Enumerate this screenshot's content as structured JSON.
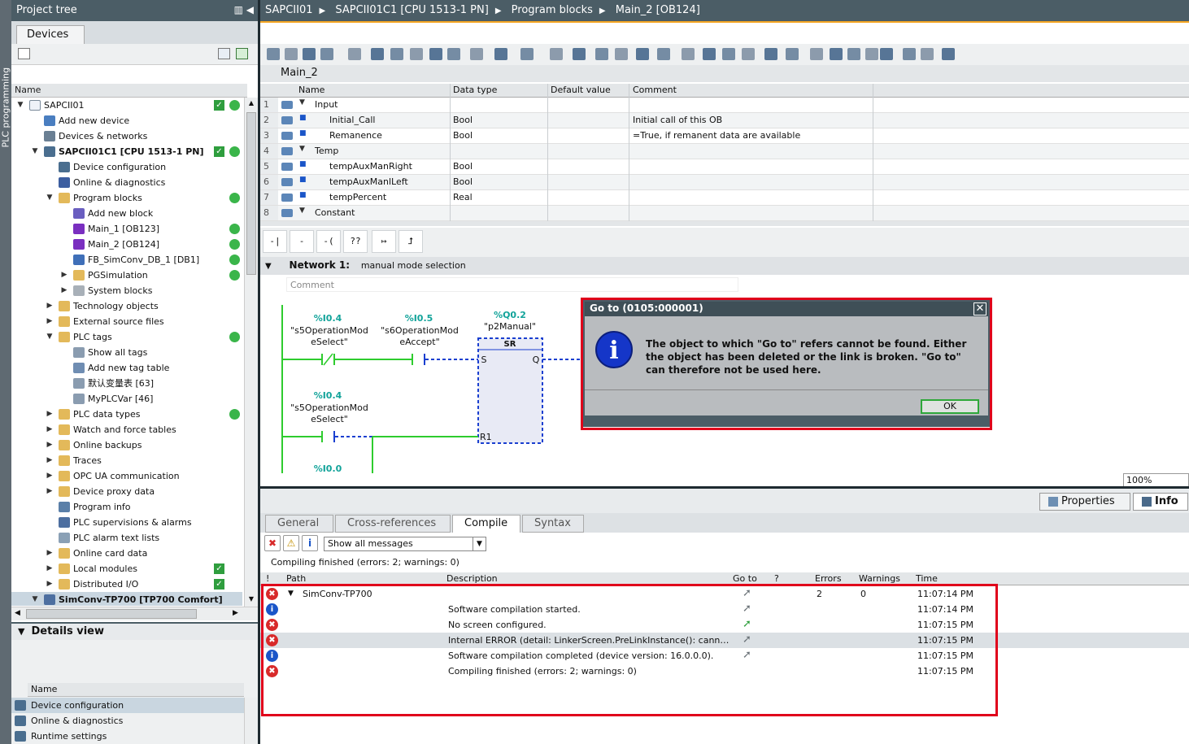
{
  "left_strip_label": "PLC programming",
  "project_tree": {
    "title": "Project tree",
    "tab": "Devices",
    "column_name": "Name",
    "items": [
      {
        "label": "SAPCII01",
        "level": 0,
        "toggle": "▼",
        "icon": "project-icon",
        "check": true,
        "status": true
      },
      {
        "label": "Add new device",
        "level": 1,
        "toggle": "",
        "icon": "add-device-icon",
        "check": false,
        "status": false
      },
      {
        "label": "Devices & networks",
        "level": 1,
        "toggle": "",
        "icon": "network-icon",
        "check": false,
        "status": false
      },
      {
        "label": "SAPCII01C1 [CPU 1513-1 PN]",
        "level": 1,
        "toggle": "▼",
        "icon": "cpu-icon",
        "check": true,
        "status": true,
        "bold": true
      },
      {
        "label": "Device configuration",
        "level": 2,
        "toggle": "",
        "icon": "device-config-icon",
        "check": false,
        "status": false
      },
      {
        "label": "Online & diagnostics",
        "level": 2,
        "toggle": "",
        "icon": "diagnostics-icon",
        "check": false,
        "status": false
      },
      {
        "label": "Program blocks",
        "level": 2,
        "toggle": "▼",
        "icon": "folder-icon",
        "check": false,
        "status": true
      },
      {
        "label": "Add new block",
        "level": 3,
        "toggle": "",
        "icon": "add-block-icon",
        "check": false,
        "status": false
      },
      {
        "label": "Main_1 [OB123]",
        "level": 3,
        "toggle": "",
        "icon": "ob-icon",
        "check": false,
        "status": true
      },
      {
        "label": "Main_2 [OB124]",
        "level": 3,
        "toggle": "",
        "icon": "ob-icon",
        "check": false,
        "status": true
      },
      {
        "label": "FB_SimConv_DB_1 [DB1]",
        "level": 3,
        "toggle": "",
        "icon": "db-icon",
        "check": false,
        "status": true
      },
      {
        "label": "PGSimulation",
        "level": 3,
        "toggle": "▶",
        "icon": "folder-icon",
        "check": false,
        "status": true
      },
      {
        "label": "System blocks",
        "level": 3,
        "toggle": "▶",
        "icon": "system-folder-icon",
        "check": false,
        "status": false
      },
      {
        "label": "Technology objects",
        "level": 2,
        "toggle": "▶",
        "icon": "folder-icon",
        "check": false,
        "status": false
      },
      {
        "label": "External source files",
        "level": 2,
        "toggle": "▶",
        "icon": "folder-icon",
        "check": false,
        "status": false
      },
      {
        "label": "PLC tags",
        "level": 2,
        "toggle": "▼",
        "icon": "folder-icon",
        "check": false,
        "status": true
      },
      {
        "label": "Show all tags",
        "level": 3,
        "toggle": "",
        "icon": "tag-table-icon",
        "check": false,
        "status": false
      },
      {
        "label": "Add new tag table",
        "level": 3,
        "toggle": "",
        "icon": "add-tag-table-icon",
        "check": false,
        "status": false
      },
      {
        "label": "默认变量表 [63]",
        "level": 3,
        "toggle": "",
        "icon": "tag-table-icon",
        "check": false,
        "status": false
      },
      {
        "label": "MyPLCVar [46]",
        "level": 3,
        "toggle": "",
        "icon": "tag-table-icon",
        "check": false,
        "status": false
      },
      {
        "label": "PLC data types",
        "level": 2,
        "toggle": "▶",
        "icon": "folder-icon",
        "check": false,
        "status": true
      },
      {
        "label": "Watch and force tables",
        "level": 2,
        "toggle": "▶",
        "icon": "folder-icon",
        "check": false,
        "status": false
      },
      {
        "label": "Online backups",
        "level": 2,
        "toggle": "▶",
        "icon": "folder-icon",
        "check": false,
        "status": false
      },
      {
        "label": "Traces",
        "level": 2,
        "toggle": "▶",
        "icon": "folder-icon",
        "check": false,
        "status": false
      },
      {
        "label": "OPC UA communication",
        "level": 2,
        "toggle": "▶",
        "icon": "folder-icon",
        "check": false,
        "status": false
      },
      {
        "label": "Device proxy data",
        "level": 2,
        "toggle": "▶",
        "icon": "folder-icon",
        "check": false,
        "status": false
      },
      {
        "label": "Program info",
        "level": 2,
        "toggle": "",
        "icon": "program-info-icon",
        "check": false,
        "status": false
      },
      {
        "label": "PLC supervisions & alarms",
        "level": 2,
        "toggle": "",
        "icon": "alarms-icon",
        "check": false,
        "status": false
      },
      {
        "label": "PLC alarm text lists",
        "level": 2,
        "toggle": "",
        "icon": "text-list-icon",
        "check": false,
        "status": false
      },
      {
        "label": "Online card data",
        "level": 2,
        "toggle": "▶",
        "icon": "folder-icon",
        "check": false,
        "status": false
      },
      {
        "label": "Local modules",
        "level": 2,
        "toggle": "▶",
        "icon": "folder-icon",
        "check": true,
        "status": false
      },
      {
        "label": "Distributed I/O",
        "level": 2,
        "toggle": "▶",
        "icon": "folder-icon",
        "check": true,
        "status": false
      },
      {
        "label": "SimConv-TP700 [TP700 Comfort]",
        "level": 1,
        "toggle": "▼",
        "icon": "hmi-icon",
        "check": false,
        "status": false,
        "bold": true,
        "selected": true
      }
    ]
  },
  "details_view": {
    "title": "Details view",
    "column_name": "Name",
    "items": [
      {
        "label": "Device configuration",
        "icon": "device-config-icon",
        "selected": true
      },
      {
        "label": "Online & diagnostics",
        "icon": "diagnostics-icon"
      },
      {
        "label": "Runtime settings",
        "icon": "runtime-settings-icon"
      }
    ]
  },
  "breadcrumb": [
    "SAPCII01",
    "SAPCII01C1 [CPU 1513-1 PN]",
    "Program blocks",
    "Main_2 [OB124]"
  ],
  "block_title": "Main_2",
  "interface": {
    "headers": {
      "name": "Name",
      "type": "Data type",
      "default": "Default value",
      "comment": "Comment"
    },
    "rows": [
      {
        "n": "1",
        "name": "Input",
        "indent": 0,
        "section": true,
        "type": "",
        "default": "",
        "comment": ""
      },
      {
        "n": "2",
        "name": "Initial_Call",
        "indent": 1,
        "section": false,
        "type": "Bool",
        "default": "",
        "comment": "Initial call of this OB"
      },
      {
        "n": "3",
        "name": "Remanence",
        "indent": 1,
        "section": false,
        "type": "Bool",
        "default": "",
        "comment": "=True, if remanent data are available"
      },
      {
        "n": "4",
        "name": "Temp",
        "indent": 0,
        "section": true,
        "type": "",
        "default": "",
        "comment": ""
      },
      {
        "n": "5",
        "name": "tempAuxManRight",
        "indent": 1,
        "section": false,
        "type": "Bool",
        "default": "",
        "comment": ""
      },
      {
        "n": "6",
        "name": "tempAuxManlLeft",
        "indent": 1,
        "section": false,
        "type": "Bool",
        "default": "",
        "comment": ""
      },
      {
        "n": "7",
        "name": "tempPercent",
        "indent": 1,
        "section": false,
        "type": "Real",
        "default": "",
        "comment": ""
      },
      {
        "n": "8",
        "name": "Constant",
        "indent": 0,
        "section": true,
        "type": "",
        "default": "",
        "comment": ""
      }
    ]
  },
  "lad_toolbar": [
    "-| |-",
    "-|/|-",
    "-( )-",
    "??",
    "↦",
    "⮥"
  ],
  "network": {
    "title": "Network 1:",
    "description": "manual mode selection",
    "comment_placeholder": "Comment",
    "contacts": [
      {
        "addr": "%I0.4",
        "name": "\"s5OperationMod",
        "name2": "eSelect\""
      },
      {
        "addr": "%I0.5",
        "name": "\"s6OperationMod",
        "name2": "eAccept\""
      },
      {
        "addr": "%I0.4",
        "name": "\"s5OperationMod",
        "name2": "eSelect\""
      },
      {
        "addr": "%I0.0",
        "name": "",
        "name2": ""
      }
    ],
    "coil": {
      "addr": "%Q0.2",
      "name": "\"p2Manual\"",
      "box": "SR",
      "pin_s": "S",
      "pin_q": "Q",
      "pin_r": "R1"
    }
  },
  "zoom": "100%",
  "inspector": {
    "tabs": {
      "properties": "Properties",
      "info": "Info"
    },
    "subtabs": [
      "General",
      "Cross-references",
      "Compile",
      "Syntax"
    ],
    "active_subtab": "Compile",
    "filter_value": "Show all messages",
    "status": "Compiling finished (errors: 2; warnings: 0)",
    "headers": {
      "bang": "!",
      "path": "Path",
      "description": "Description",
      "goto": "Go to",
      "q": "?",
      "errors": "Errors",
      "warnings": "Warnings",
      "time": "Time"
    },
    "messages": [
      {
        "type": "error",
        "path": "SimConv-TP700",
        "description": "",
        "errors": "2",
        "warnings": "0",
        "time": "11:07:14 PM",
        "expand": "▼"
      },
      {
        "type": "info",
        "path": "",
        "description": "Software compilation started.",
        "errors": "",
        "warnings": "",
        "time": "11:07:14 PM",
        "expand": ""
      },
      {
        "type": "error",
        "path": "",
        "description": "No screen configured.",
        "errors": "",
        "warnings": "",
        "time": "11:07:15 PM",
        "expand": "",
        "goto_green": true
      },
      {
        "type": "error",
        "path": "",
        "description": "Internal ERROR (detail: LinkerScreen.PreLinkInstance(): cannot ...",
        "errors": "",
        "warnings": "",
        "time": "11:07:15 PM",
        "expand": "",
        "highlight": true
      },
      {
        "type": "info",
        "path": "",
        "description": "Software compilation completed (device version: 16.0.0.0).",
        "errors": "",
        "warnings": "",
        "time": "11:07:15 PM",
        "expand": ""
      },
      {
        "type": "error",
        "path": "",
        "description": "Compiling finished (errors: 2; warnings: 0)",
        "errors": "",
        "warnings": "",
        "time": "11:07:15 PM",
        "expand": "",
        "nogo": true
      }
    ]
  },
  "dialog": {
    "title": "Go to (0105:000001)",
    "message": "The object to which \"Go to\" refers cannot be found. Either the object has been deleted or the link is broken. \"Go to\" can therefore not be used here.",
    "ok": "OK"
  },
  "colors": {
    "header": "#4b5d66",
    "accent": "#f5a623",
    "error": "#d82a2a",
    "info": "#1a55c8",
    "ok_green": "#3ab54a",
    "highlight_box": "#e0001b"
  }
}
